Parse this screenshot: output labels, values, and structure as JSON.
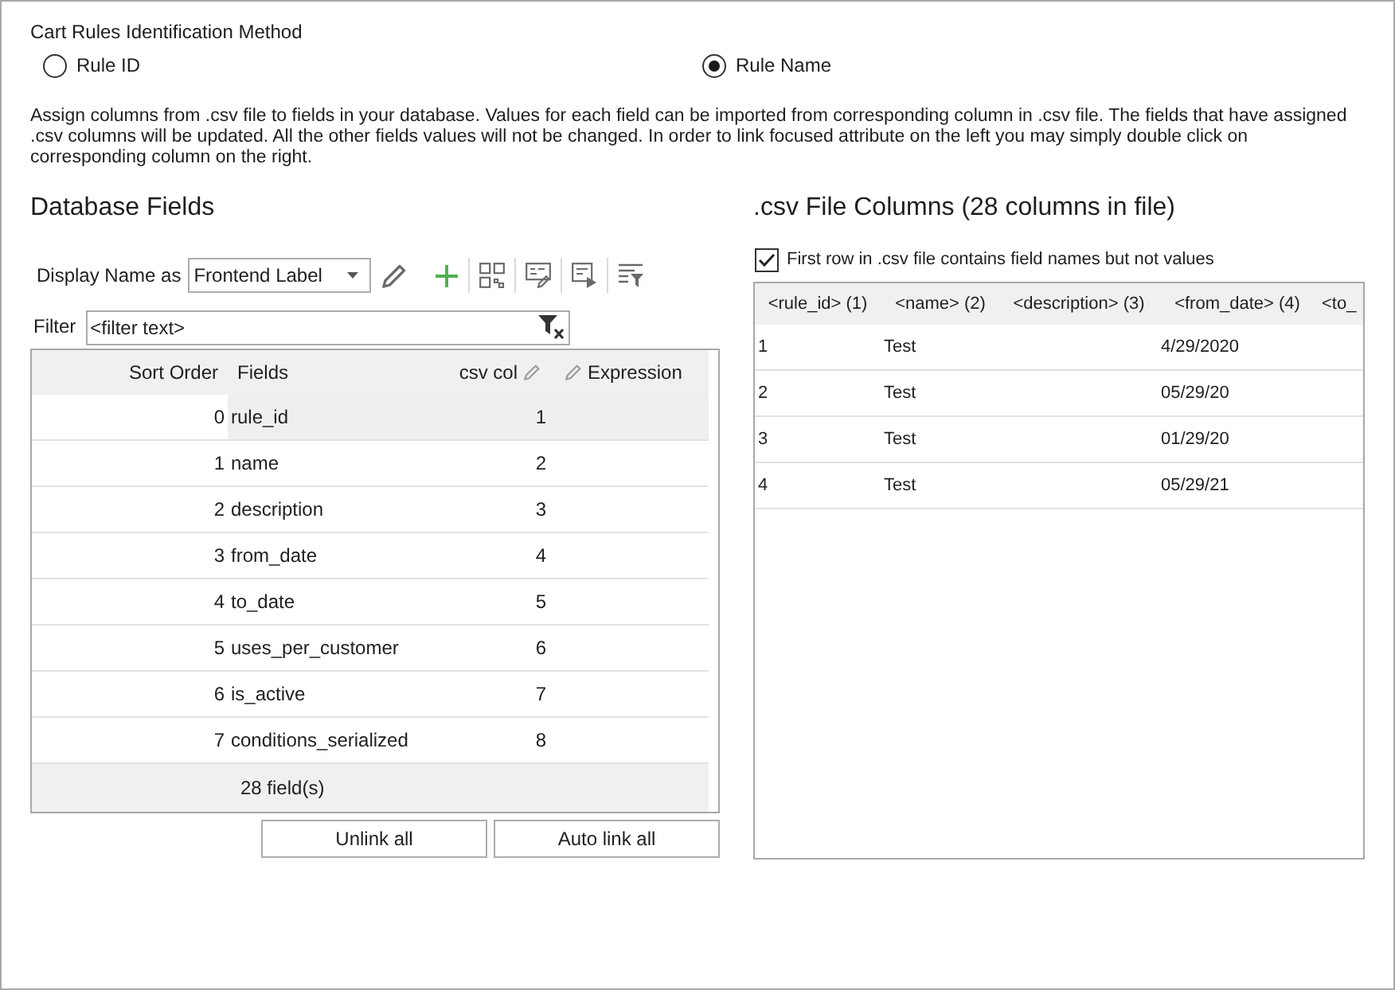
{
  "identification": {
    "label": "Cart Rules Identification Method",
    "options": [
      {
        "label": "Rule ID",
        "selected": false
      },
      {
        "label": "Rule Name",
        "selected": true
      }
    ]
  },
  "description": "Assign columns from .csv file to fields in your database. Values for each field can be imported from corresponding column in .csv file. The fields that have assigned .csv columns will be updated. All the other fields values will not be changed. In order to link focused attribute on the left you may simply double click on corresponding column on the right.",
  "database_fields": {
    "title": "Database Fields",
    "display_name_label": "Display Name as",
    "display_name_value": "Frontend Label",
    "filter_label": "Filter",
    "filter_placeholder": "<filter text>",
    "columns": [
      {
        "label": "Sort Order"
      },
      {
        "label": "Fields"
      },
      {
        "label": "csv col",
        "pencil_after": true
      },
      {
        "label": "Expression",
        "pencil_before": true
      }
    ],
    "rows": [
      {
        "sort_order": "0",
        "field": "rule_id",
        "csv_col": "1",
        "selected": true
      },
      {
        "sort_order": "1",
        "field": "name",
        "csv_col": "2",
        "selected": false
      },
      {
        "sort_order": "2",
        "field": "description",
        "csv_col": "3",
        "selected": false
      },
      {
        "sort_order": "3",
        "field": "from_date",
        "csv_col": "4",
        "selected": false
      },
      {
        "sort_order": "4",
        "field": "to_date",
        "csv_col": "5",
        "selected": false
      },
      {
        "sort_order": "5",
        "field": "uses_per_customer",
        "csv_col": "6",
        "selected": false
      },
      {
        "sort_order": "6",
        "field": "is_active",
        "csv_col": "7",
        "selected": false
      },
      {
        "sort_order": "7",
        "field": "conditions_serialized",
        "csv_col": "8",
        "selected": false
      }
    ],
    "footer": "28 field(s)",
    "buttons": [
      "Unlink all",
      "Auto link all"
    ]
  },
  "csv_columns": {
    "title": ".csv File Columns (28 columns in file)",
    "first_row_header": {
      "label": "First row in .csv file contains field names but not values",
      "checked": true
    },
    "columns": [
      "<rule_id> (1)",
      "<name> (2)",
      "<description> (3)",
      "<from_date> (4)",
      "<to_"
    ],
    "rows": [
      {
        "rule_id": "1",
        "name": "Test",
        "from_date": "4/29/2020"
      },
      {
        "rule_id": "2",
        "name": "Test",
        "from_date": "05/29/20"
      },
      {
        "rule_id": "3",
        "name": "Test",
        "from_date": "01/29/20"
      },
      {
        "rule_id": "4",
        "name": "Test",
        "from_date": "05/29/21"
      }
    ]
  }
}
